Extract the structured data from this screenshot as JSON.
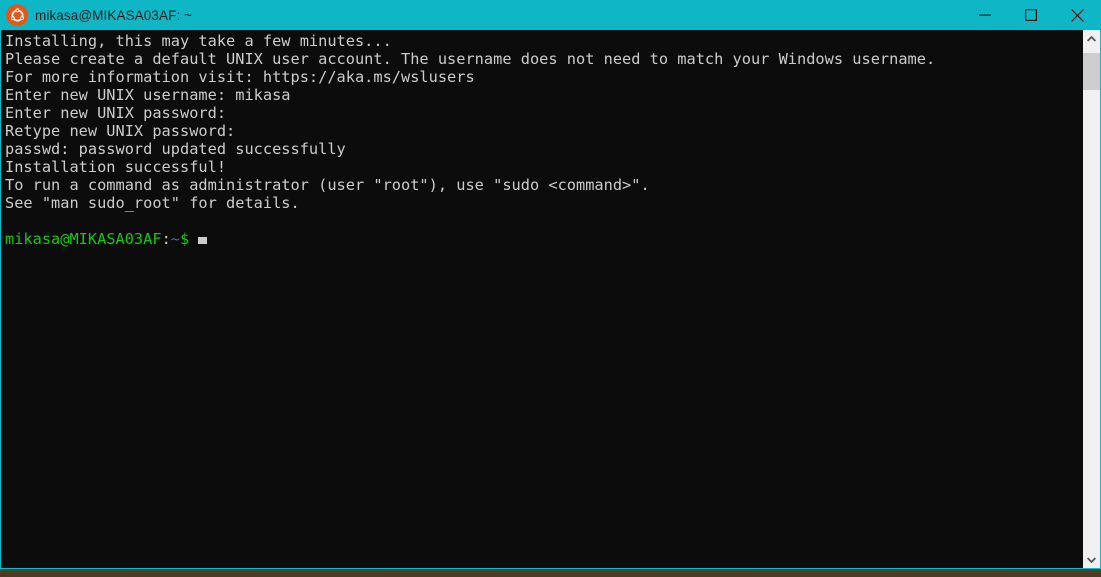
{
  "window": {
    "title": "mikasa@MIKASA03AF: ~",
    "app_icon": "ubuntu-icon",
    "controls": {
      "minimize": "Minimize",
      "maximize": "Maximize",
      "close": "Close"
    },
    "accent_color": "#0FB7C6",
    "background_color": "#0c0c0c"
  },
  "terminal": {
    "lines": [
      "Installing, this may take a few minutes...",
      "Please create a default UNIX user account. The username does not need to match your Windows username.",
      "For more information visit: https://aka.ms/wslusers",
      "Enter new UNIX username: mikasa",
      "Enter new UNIX password:",
      "Retype new UNIX password:",
      "passwd: password updated successfully",
      "Installation successful!",
      "To run a command as administrator (user \"root\"), use \"sudo <command>\".",
      "See \"man sudo_root\" for details.",
      ""
    ],
    "prompt": {
      "user_host": "mikasa@MIKASA03AF",
      "separator": ":",
      "path": "~",
      "symbol": "$",
      "input": "",
      "cursor": "block-cursor",
      "colors": {
        "user_host": "#16C60C",
        "path": "#2c6fd6",
        "text": "#cccccc"
      }
    }
  },
  "scrollbar": {
    "up_arrow": "chevron-up-icon",
    "down_arrow": "chevron-down-icon",
    "thumb": "scrollbar-thumb"
  }
}
